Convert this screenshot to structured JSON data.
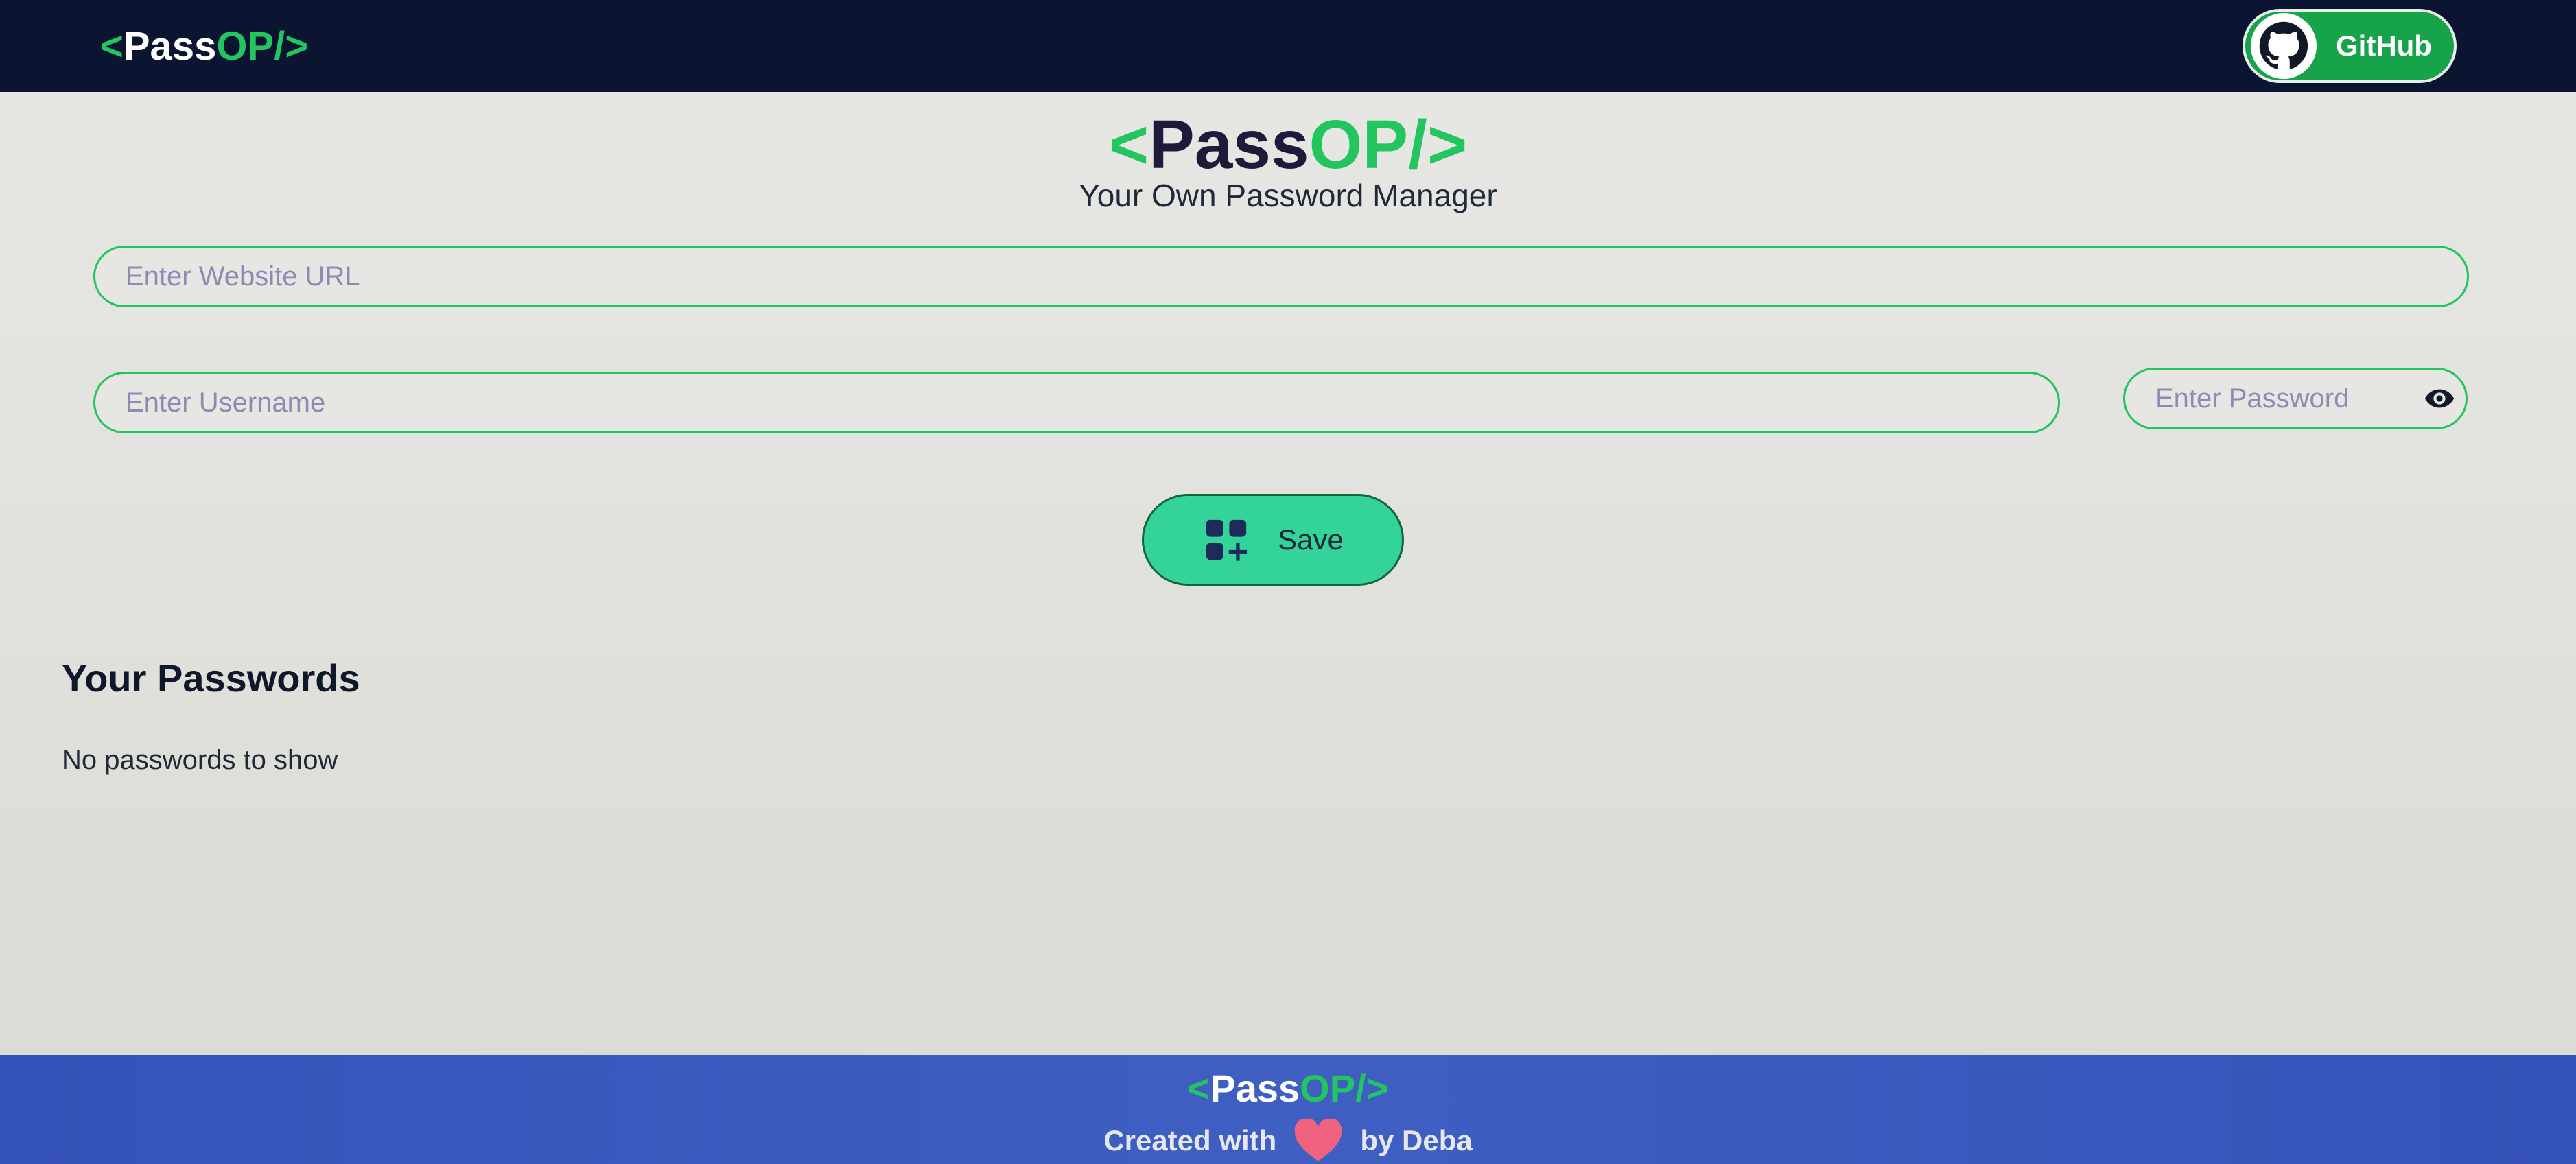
{
  "navbar": {
    "logo": {
      "open": "<",
      "pass": "Pass",
      "op": "OP/",
      "close": ">"
    },
    "github_label": "GitHub"
  },
  "header": {
    "logo": {
      "open": "<",
      "pass": "Pass",
      "op": "OP/",
      "close": ">"
    },
    "tagline": "Your Own Password Manager"
  },
  "form": {
    "url_placeholder": "Enter Website URL",
    "username_placeholder": "Enter Username",
    "password_placeholder": "Enter Password",
    "save_label": "Save"
  },
  "passwords": {
    "title": "Your Passwords",
    "empty_message": "No passwords to show"
  },
  "footer": {
    "logo": {
      "open": "<",
      "pass": "Pass",
      "op": "OP/",
      "close": ">"
    },
    "created_with": "Created with",
    "by": "by Deba"
  },
  "icons": {
    "github": "github-icon",
    "eye": "eye-icon",
    "save": "add-grid-icon",
    "heart": "heart-icon"
  },
  "colors": {
    "navbar": "#0b1430",
    "accent_green": "#22c55e",
    "save_button": "#34d399",
    "footer": "#3f5fc2"
  }
}
